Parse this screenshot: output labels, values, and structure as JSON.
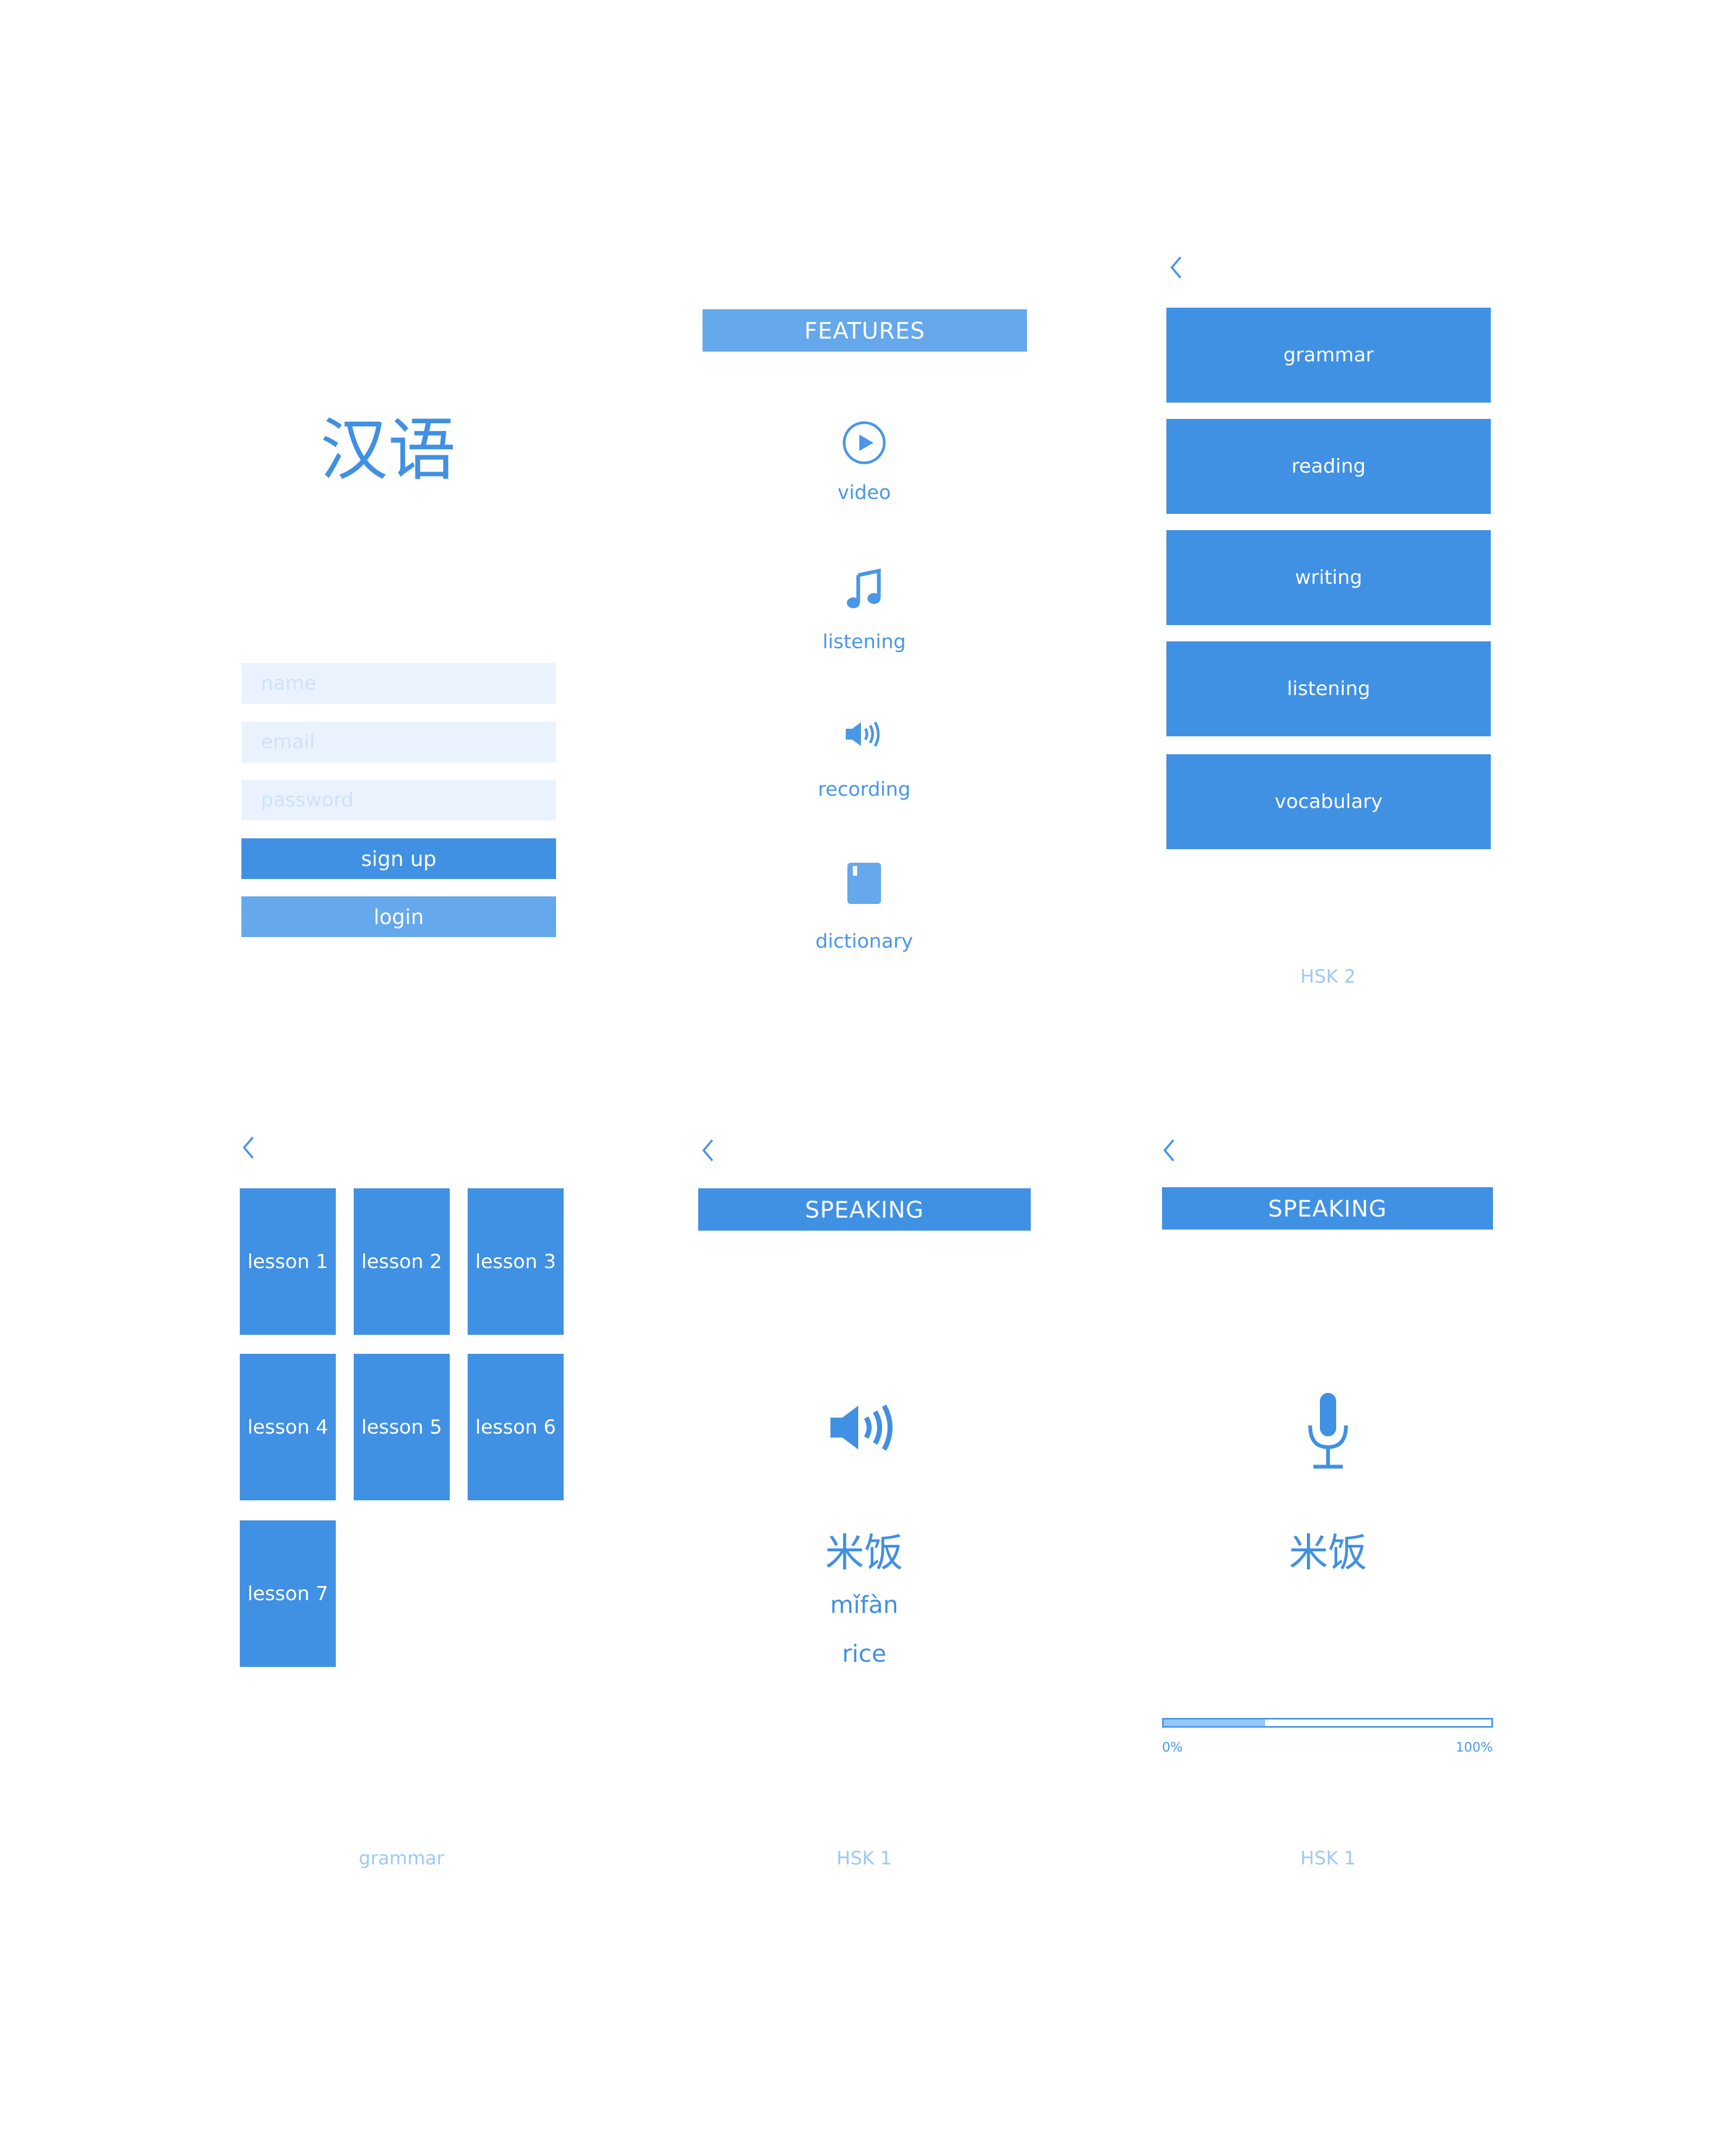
{
  "colors": {
    "primary": "#4091e4",
    "secondary": "#65a8eb",
    "input_bg": "#eaf3fd",
    "muted_text": "#9ccaf8"
  },
  "login_screen": {
    "title": "汉语",
    "name_placeholder": "name",
    "email_placeholder": "email",
    "password_placeholder": "password",
    "signup_label": "sign up",
    "login_label": "login"
  },
  "features_screen": {
    "header": "FEATURES",
    "items": [
      {
        "label": "video",
        "icon": "play-circle-icon"
      },
      {
        "label": "listening",
        "icon": "music-note-icon"
      },
      {
        "label": "recording",
        "icon": "speaker-icon"
      },
      {
        "label": "dictionary",
        "icon": "book-icon"
      }
    ]
  },
  "category_screen": {
    "back_icon": "chevron-left-icon",
    "items": [
      "grammar",
      "reading",
      "writing",
      "listening",
      "vocabulary"
    ],
    "footer": "HSK 2"
  },
  "lessons_screen": {
    "back_icon": "chevron-left-icon",
    "lessons": [
      "lesson 1",
      "lesson 2",
      "lesson 3",
      "lesson 4",
      "lesson 5",
      "lesson 6",
      "lesson 7"
    ],
    "footer": "grammar"
  },
  "speaking_listen_screen": {
    "back_icon": "chevron-left-icon",
    "header": "SPEAKING",
    "icon": "speaker-icon",
    "hanzi": "米饭",
    "pinyin": "mǐfàn",
    "translation": "rice",
    "footer": "HSK 1"
  },
  "speaking_record_screen": {
    "back_icon": "chevron-left-icon",
    "header": "SPEAKING",
    "icon": "microphone-icon",
    "hanzi": "米饭",
    "progress_percent": 31,
    "progress_min_label": "0%",
    "progress_max_label": "100%",
    "footer": "HSK 1"
  }
}
